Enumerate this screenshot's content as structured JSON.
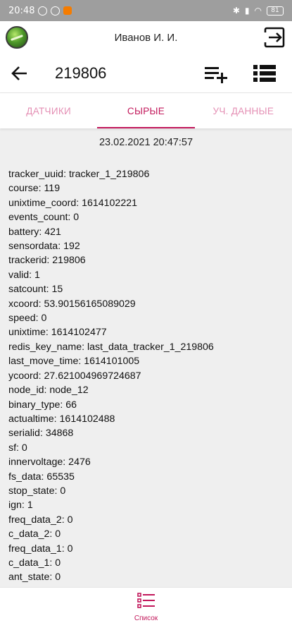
{
  "status_bar": {
    "time": "20:48",
    "battery": "81"
  },
  "header": {
    "user_name": "Иванов И. И."
  },
  "toolbar": {
    "title": "219806"
  },
  "tabs": [
    {
      "label": "ДАТЧИКИ",
      "active": false
    },
    {
      "label": "СЫРЫЕ",
      "active": true
    },
    {
      "label": "УЧ. ДАННЫЕ",
      "active": false
    }
  ],
  "content": {
    "timestamp": "23.02.2021 20:47:57",
    "rows": [
      "tracker_uuid: tracker_1_219806",
      "course: 119",
      "unixtime_coord: 1614102221",
      "events_count: 0",
      "battery: 421",
      "sensordata: 192",
      "trackerid: 219806",
      "valid: 1",
      "satcount: 15",
      "xcoord: 53.90156165089029",
      "speed: 0",
      "unixtime: 1614102477",
      "redis_key_name: last_data_tracker_1_219806",
      "last_move_time: 1614101005",
      "ycoord: 27.621004969724687",
      "node_id: node_12",
      "binary_type: 66",
      "actualtime: 1614102488",
      "serialid: 34868",
      "sf: 0",
      "innervoltage: 2476",
      "fs_data: 65535",
      "stop_state: 0",
      "ign: 1",
      "freq_data_2: 0",
      "c_data_2: 0",
      "freq_data_1: 0",
      "c_data_1: 0",
      "ant_state: 0"
    ]
  },
  "bottom_nav": {
    "label": "Список"
  },
  "colors": {
    "accent": "#c2185b",
    "tab_inactive": "#e48fb4",
    "background": "#efefef"
  }
}
